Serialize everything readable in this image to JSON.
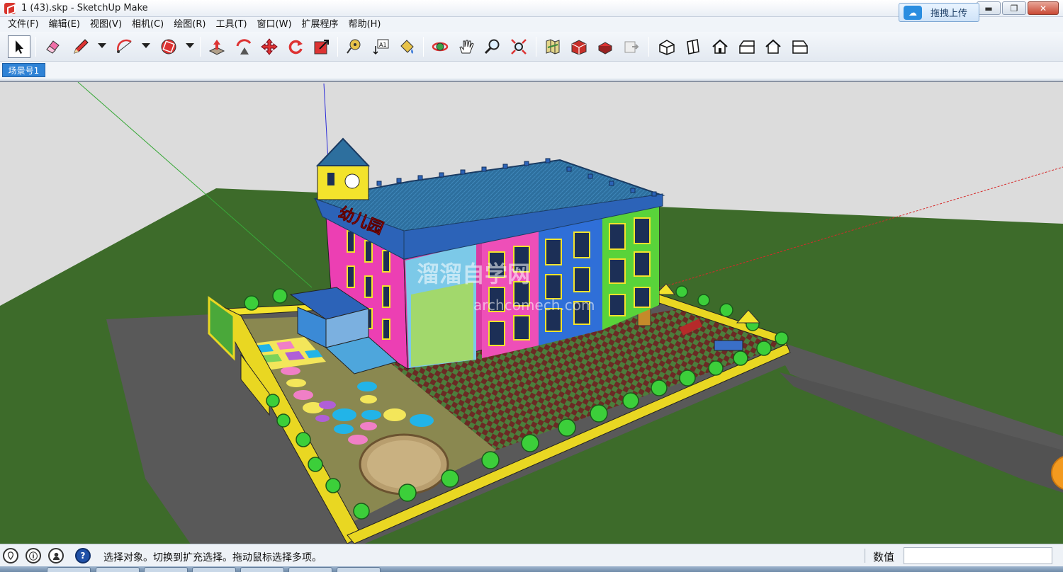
{
  "window": {
    "title": "1 (43).skp - SketchUp Make",
    "minimize_glyph": "▬",
    "restore_glyph": "❐",
    "close_glyph": "✕"
  },
  "menu": {
    "items": [
      "文件(F)",
      "编辑(E)",
      "视图(V)",
      "相机(C)",
      "绘图(R)",
      "工具(T)",
      "窗口(W)",
      "扩展程序",
      "帮助(H)"
    ]
  },
  "upload": {
    "label": "拖拽上传",
    "icon": "cloud-upload-icon"
  },
  "scene": {
    "tab_label": "场景号1"
  },
  "viewport": {
    "watermark_main": "溜溜自学网",
    "watermark_url": "archcomech.com",
    "building_sign": "幼儿园"
  },
  "status": {
    "text": "选择对象。切换到扩充选择。拖动鼠标选择多项。",
    "measure_label": "数值",
    "measure_value": ""
  },
  "colors": {
    "accent": "#2f83d6",
    "ground_green": "#3d6b2a",
    "road_gray": "#5a5a5a",
    "roof_blue": "#2d6f9e"
  }
}
